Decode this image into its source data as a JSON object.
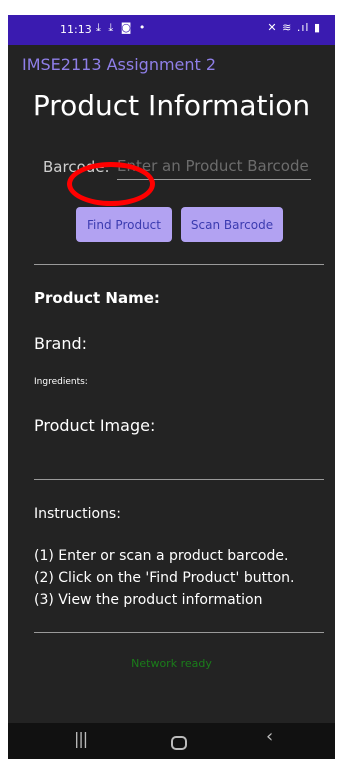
{
  "status_bar": {
    "time": "11:13",
    "left_icons": "⤓ ⤓ ◙ •",
    "right_icons": "✕ ≋ .ıl ▮"
  },
  "app": {
    "title": "IMSE2113 Assignment 2"
  },
  "page": {
    "title": "Product Information"
  },
  "barcode": {
    "label": "Barcode:",
    "placeholder": "Enter an Product Barcode",
    "value": ""
  },
  "buttons": {
    "find_label": "Find Product",
    "scan_label": "Scan Barcode"
  },
  "product": {
    "name_label": "Product Name:",
    "brand_label": "Brand:",
    "ingredients_label": "Ingredients:",
    "image_label": "Product Image:"
  },
  "instructions": {
    "title": "Instructions:",
    "lines": [
      "(1) Enter or scan a product barcode.",
      "(2) Click on the 'Find Product' button.",
      "(3) View the product information"
    ]
  },
  "network_status": "Network ready",
  "nav": {
    "recent": "|||",
    "back": "‹"
  },
  "colors": {
    "status_bar_bg": "#3a1bb0",
    "app_title": "#8f7fe8",
    "button_bg": "#b2a2f2",
    "network_ok": "#1a7d1a",
    "annotation": "#ff0000"
  }
}
